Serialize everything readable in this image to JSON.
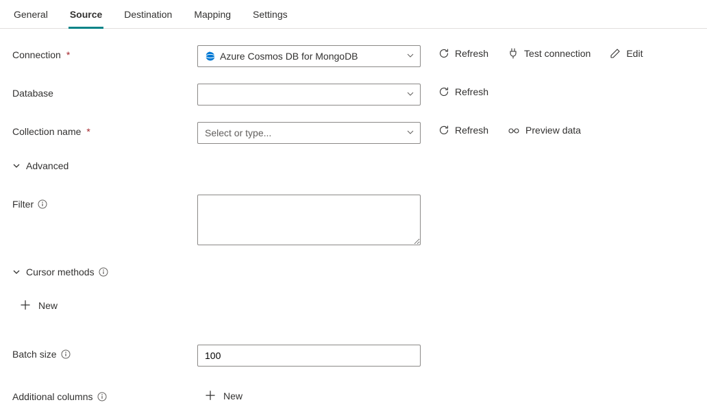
{
  "tabs": {
    "general": "General",
    "source": "Source",
    "destination": "Destination",
    "mapping": "Mapping",
    "settings": "Settings"
  },
  "labels": {
    "connection": "Connection",
    "database": "Database",
    "collection": "Collection name",
    "advanced": "Advanced",
    "filter": "Filter",
    "cursor": "Cursor methods",
    "batch": "Batch size",
    "additional": "Additional columns"
  },
  "fields": {
    "connection_value": "Azure Cosmos DB for MongoDB",
    "database_value": "",
    "collection_placeholder": "Select or type...",
    "filter_value": "",
    "batch_value": "100"
  },
  "actions": {
    "refresh": "Refresh",
    "test": "Test connection",
    "edit": "Edit",
    "preview": "Preview data",
    "new": "New"
  }
}
